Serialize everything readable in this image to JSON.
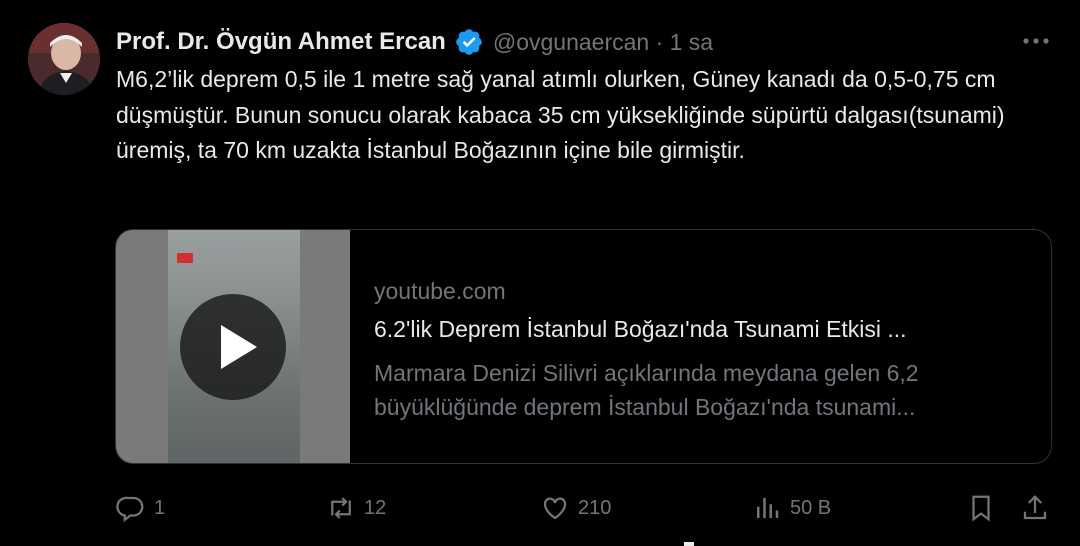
{
  "tweet": {
    "author_name": "Prof. Dr. Övgün Ahmet Ercan",
    "handle_time": "@ovgunaercan · 1 sa",
    "text": "M6,2’lik deprem 0,5 ile 1 metre sağ yanal atımlı olurken, Güney kanadı da 0,5-0,75 cm düşmüştür. Bunun sonucu olarak kabaca 35 cm yüksekliğinde süpürtü dalgası(tsunami) üremiş, ta 70 km uzakta İstanbul Boğazının içine bile girmiştir."
  },
  "card": {
    "domain": "youtube.com",
    "title": "6.2'lik Deprem İstanbul Boğazı'nda Tsunami Etkisi ...",
    "description": "Marmara Denizi Silivri açıklarında meydana gelen 6,2 büyüklüğünde deprem İstanbul Boğazı'nda tsunami..."
  },
  "actions": {
    "reply_count": "1",
    "retweet_count": "12",
    "like_count": "210",
    "views_count": "50 B"
  },
  "icons": {
    "verified": "verified-badge-icon",
    "more": "more-icon",
    "reply": "reply-icon",
    "retweet": "retweet-icon",
    "like": "heart-icon",
    "views": "views-icon",
    "bookmark": "bookmark-icon",
    "share": "share-icon",
    "play": "play-icon"
  },
  "colors": {
    "background": "#000000",
    "text": "#e7e9ea",
    "muted": "#71767b",
    "verified": "#1d9bf0"
  }
}
